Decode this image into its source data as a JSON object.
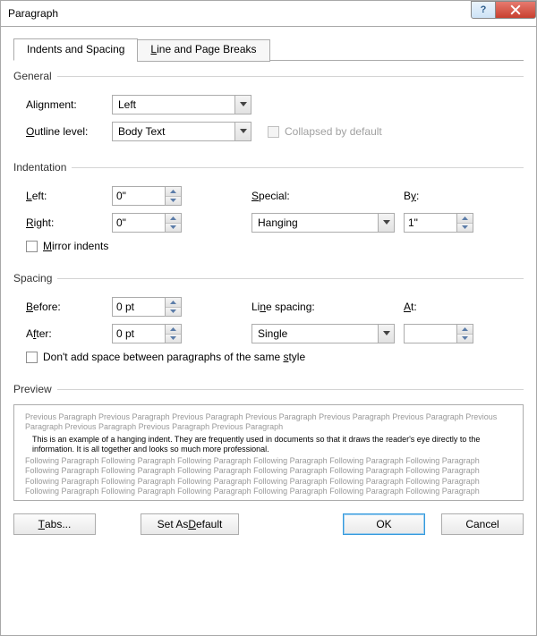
{
  "title": "Paragraph",
  "tabs": {
    "indents": "Indents and Spacing",
    "breaks": "Line and Page Breaks"
  },
  "general": {
    "legend": "General",
    "alignment_label": "Alignment:",
    "alignment_value": "Left",
    "outline_label": "Outline level:",
    "outline_value": "Body Text",
    "collapsed_label": "Collapsed by default"
  },
  "indent": {
    "legend": "Indentation",
    "left_label": "Left:",
    "left_value": "0\"",
    "right_label": "Right:",
    "right_value": "0\"",
    "special_label": "Special:",
    "special_value": "Hanging",
    "by_label": "By:",
    "by_value": "1\"",
    "mirror_label": "Mirror indents"
  },
  "spacing": {
    "legend": "Spacing",
    "before_label": "Before:",
    "before_value": "0 pt",
    "after_label": "After:",
    "after_value": "0 pt",
    "line_label": "Line spacing:",
    "line_value": "Single",
    "at_label": "At:",
    "at_value": "",
    "nospace_label": "Don't add space between paragraphs of the same style"
  },
  "preview": {
    "legend": "Preview",
    "prev_text": "Previous Paragraph Previous Paragraph Previous Paragraph Previous Paragraph Previous Paragraph Previous Paragraph Previous Paragraph Previous Paragraph Previous Paragraph Previous Paragraph",
    "sample_text": "This is an example of a hanging indent.  They are frequently used in documents so that it draws the reader's eye directly to the information.  It is all together and looks so much more professional.",
    "foll_text": "Following Paragraph Following Paragraph Following Paragraph Following Paragraph Following Paragraph Following Paragraph Following Paragraph Following Paragraph Following Paragraph Following Paragraph Following Paragraph Following Paragraph Following Paragraph Following Paragraph Following Paragraph Following Paragraph Following Paragraph Following Paragraph Following Paragraph Following Paragraph Following Paragraph Following Paragraph Following Paragraph Following Paragraph"
  },
  "buttons": {
    "tabs": "Tabs...",
    "default": "Set As Default",
    "ok": "OK",
    "cancel": "Cancel"
  }
}
